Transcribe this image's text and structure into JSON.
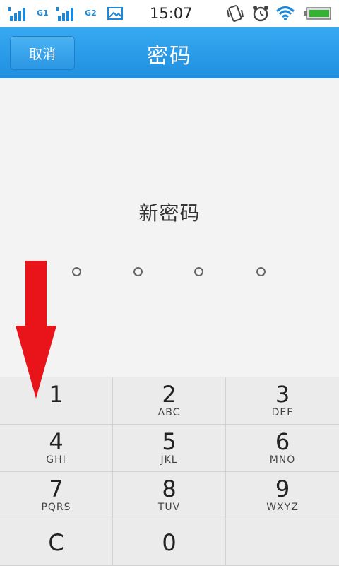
{
  "status_bar": {
    "sim1_label": "G1",
    "sim2_label": "G2",
    "time": "15:07",
    "icons": [
      "signal-icon",
      "signal-icon",
      "picture-icon",
      "vibrate-icon",
      "alarm-clock-icon",
      "wifi-icon",
      "battery-icon"
    ]
  },
  "header": {
    "cancel_label": "取消",
    "title": "密码"
  },
  "main": {
    "prompt": "新密码",
    "pin_length": 4
  },
  "keypad": {
    "keys": [
      {
        "num": "1",
        "letters": ""
      },
      {
        "num": "2",
        "letters": "ABC"
      },
      {
        "num": "3",
        "letters": "DEF"
      },
      {
        "num": "4",
        "letters": "GHI"
      },
      {
        "num": "5",
        "letters": "JKL"
      },
      {
        "num": "6",
        "letters": "MNO"
      },
      {
        "num": "7",
        "letters": "PQRS"
      },
      {
        "num": "8",
        "letters": "TUV"
      },
      {
        "num": "9",
        "letters": "WXYZ"
      },
      {
        "num": "C",
        "letters": ""
      },
      {
        "num": "0",
        "letters": ""
      },
      {
        "num": "",
        "letters": ""
      }
    ]
  },
  "colors": {
    "header_blue": "#2a9be6",
    "arrow_red": "#e8141a",
    "status_blue": "#1e88d8"
  }
}
